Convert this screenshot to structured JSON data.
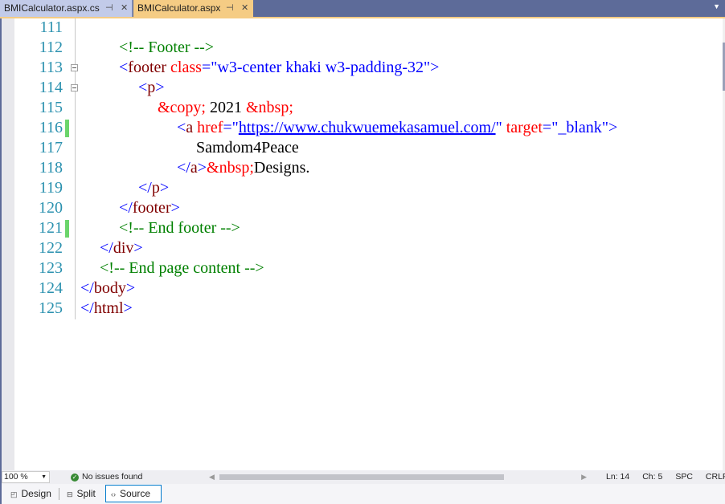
{
  "tabs": [
    {
      "label": "BMICalculator.aspx.cs",
      "active": false
    },
    {
      "label": "BMICalculator.aspx",
      "active": true
    }
  ],
  "tab_icons": {
    "pin": "pin-icon",
    "close": "close-icon"
  },
  "colors": {
    "tag_bracket": "#0000ff",
    "tag_name": "#800000",
    "attribute": "#ff0000",
    "value": "#0000ff",
    "comment": "#008000",
    "entity": "#ff0000",
    "line_number": "#2b91af",
    "active_tab": "#f5cc84",
    "changed_marker": "#6bd56b"
  },
  "lines": [
    {
      "n": "111",
      "indent": 0,
      "tokens": []
    },
    {
      "n": "112",
      "indent": 8,
      "tokens": [
        [
          "c",
          "<!-- Footer -->"
        ]
      ]
    },
    {
      "n": "113",
      "indent": 8,
      "fold": true,
      "tokens": [
        [
          "b",
          "<"
        ],
        [
          "t",
          "footer"
        ],
        [
          "x",
          " "
        ],
        [
          "a",
          "class"
        ],
        [
          "b",
          "=\""
        ],
        [
          "v",
          "w3-center khaki w3-padding-32"
        ],
        [
          "b",
          "\">"
        ]
      ]
    },
    {
      "n": "114",
      "indent": 12,
      "fold": true,
      "tokens": [
        [
          "b",
          "<"
        ],
        [
          "t",
          "p"
        ],
        [
          "b",
          ">"
        ]
      ]
    },
    {
      "n": "115",
      "indent": 16,
      "tokens": [
        [
          "e",
          "&copy;"
        ],
        [
          "x",
          " 2021 "
        ],
        [
          "e",
          "&nbsp;"
        ]
      ]
    },
    {
      "n": "116",
      "indent": 20,
      "changed": true,
      "tokens": [
        [
          "b",
          "<"
        ],
        [
          "t",
          "a"
        ],
        [
          "x",
          " "
        ],
        [
          "a",
          "href"
        ],
        [
          "b",
          "=\""
        ],
        [
          "u",
          "https://www.chukwuemekasamuel.com/"
        ],
        [
          "b",
          "\""
        ],
        [
          "x",
          " "
        ],
        [
          "a",
          "target"
        ],
        [
          "b",
          "=\""
        ],
        [
          "v",
          "_blank"
        ],
        [
          "b",
          "\">"
        ]
      ]
    },
    {
      "n": "117",
      "indent": 24,
      "tokens": [
        [
          "x",
          "Samdom4Peace"
        ]
      ]
    },
    {
      "n": "118",
      "indent": 20,
      "tokens": [
        [
          "b",
          "</"
        ],
        [
          "t",
          "a"
        ],
        [
          "b",
          ">"
        ],
        [
          "e",
          "&nbsp;"
        ],
        [
          "x",
          "Designs."
        ]
      ]
    },
    {
      "n": "119",
      "indent": 12,
      "tokens": [
        [
          "b",
          "</"
        ],
        [
          "t",
          "p"
        ],
        [
          "b",
          ">"
        ]
      ]
    },
    {
      "n": "120",
      "indent": 8,
      "tokens": [
        [
          "b",
          "</"
        ],
        [
          "t",
          "footer"
        ],
        [
          "b",
          ">"
        ]
      ]
    },
    {
      "n": "121",
      "indent": 8,
      "changed": true,
      "tokens": [
        [
          "c",
          "<!-- End footer -->"
        ]
      ]
    },
    {
      "n": "122",
      "indent": 4,
      "tokens": [
        [
          "b",
          "</"
        ],
        [
          "t",
          "div"
        ],
        [
          "b",
          ">"
        ]
      ]
    },
    {
      "n": "123",
      "indent": 4,
      "tokens": [
        [
          "c",
          "<!-- End page content -->"
        ]
      ]
    },
    {
      "n": "124",
      "indent": 0,
      "tokens": [
        [
          "b",
          "</"
        ],
        [
          "t",
          "body"
        ],
        [
          "b",
          ">"
        ]
      ]
    },
    {
      "n": "125",
      "indent": 0,
      "tokens": [
        [
          "b",
          "</"
        ],
        [
          "t",
          "html"
        ],
        [
          "b",
          ">"
        ]
      ]
    }
  ],
  "status": {
    "zoom": "100 %",
    "issues": "No issues found",
    "ln": "Ln: 14",
    "ch": "Ch: 5",
    "spc": "SPC",
    "crlf": "CRLF"
  },
  "views": {
    "design": "Design",
    "split": "Split",
    "source": "Source",
    "active": "Source"
  }
}
